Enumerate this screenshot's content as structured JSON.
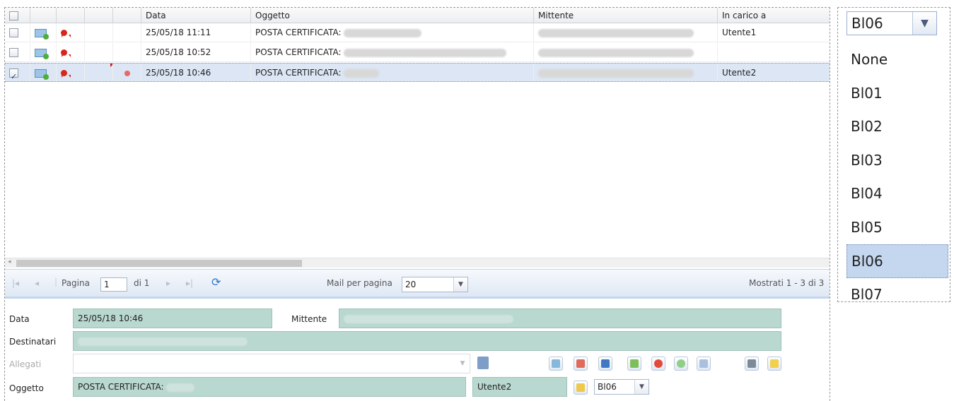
{
  "grid": {
    "headers": {
      "data": "Data",
      "oggetto": "Oggetto",
      "mittente": "Mittente",
      "incarico": "In carico a"
    },
    "rows": [
      {
        "date": "25/05/18 11:11",
        "subject": "POSTA CERTIFICATA:",
        "assignee": "Utente1",
        "checked": false
      },
      {
        "date": "25/05/18 10:52",
        "subject": "POSTA CERTIFICATA:",
        "assignee": "",
        "checked": false
      },
      {
        "date": "25/05/18 10:46",
        "subject": "POSTA CERTIFICATA:",
        "assignee": "Utente2",
        "checked": true
      }
    ]
  },
  "pager": {
    "page_label": "Pagina",
    "page_value": "1",
    "of_label": "di 1",
    "per_page_label": "Mail per pagina",
    "per_page_value": "20",
    "shown_label": "Mostrati 1 - 3 di 3"
  },
  "detail": {
    "data_label": "Data",
    "data_value": "25/05/18 10:46",
    "mittente_label": "Mittente",
    "destinatari_label": "Destinatari",
    "allegati_label": "Allegati",
    "oggetto_label": "Oggetto",
    "oggetto_value": "POSTA CERTIFICATA:",
    "assignee_value": "Utente2",
    "folder_value": "Bl06"
  },
  "dropdown": {
    "selected": "Bl06",
    "options": [
      "None",
      "Bl01",
      "Bl02",
      "Bl03",
      "Bl04",
      "Bl05",
      "Bl06",
      "Bl07"
    ]
  }
}
